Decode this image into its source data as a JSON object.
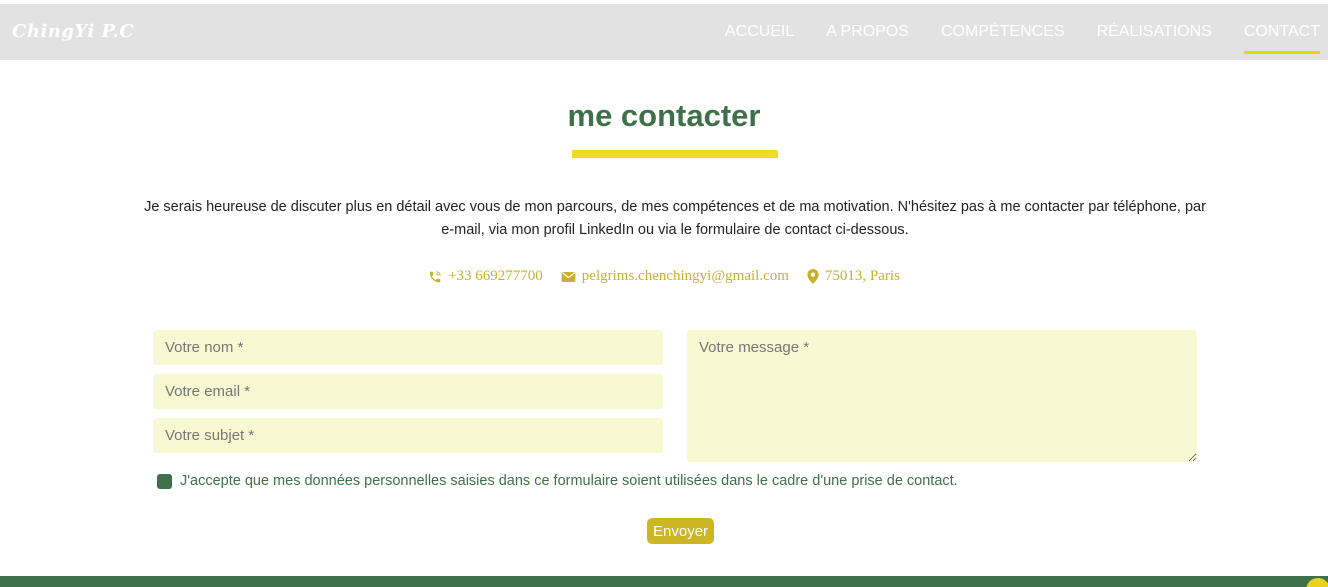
{
  "header": {
    "logo": "ChingYi P.C",
    "nav": [
      {
        "label": "ACCUEIL",
        "active": false
      },
      {
        "label": "A PROPOS",
        "active": false
      },
      {
        "label": "COMPÉTENCES",
        "active": false
      },
      {
        "label": "RÉALISATIONS",
        "active": false
      },
      {
        "label": "CONTACT",
        "active": true
      }
    ]
  },
  "contact": {
    "title": "me contacter",
    "intro": "Je serais heureuse de discuter plus en détail avec vous de mon parcours, de mes compétences et de ma motivation. N'hésitez pas à me contacter par téléphone, par e-mail, via mon profil LinkedIn ou via le formulaire de contact ci-dessous.",
    "phone": "+33  669277700",
    "email": "pelgrims.chenchingyi@gmail.com",
    "location": "75013,  Paris"
  },
  "form": {
    "name_placeholder": "Votre nom *",
    "email_placeholder": "Votre email *",
    "subject_placeholder": "Votre subjet *",
    "message_placeholder": "Votre message *",
    "consent_label": "J'accepte que mes données personnelles saisies dans ce formulaire soient utilisées dans le cadre d'une prise de contact.",
    "submit_label": "Envoyer"
  },
  "colors": {
    "accent_green": "#3e7149",
    "accent_yellow": "#eedc20",
    "field_bg": "#f8f8d2",
    "nav_bg": "#e2e2e2"
  },
  "icons": [
    "phone-icon",
    "envelope-icon",
    "map-pin-icon",
    "scroll-top-icon"
  ]
}
